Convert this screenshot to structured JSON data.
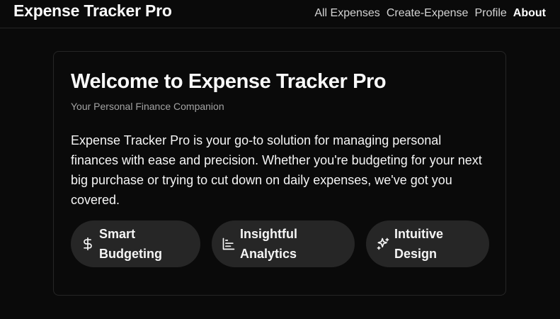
{
  "app": {
    "brand": "Expense Tracker Pro"
  },
  "nav": {
    "links": [
      {
        "label": "All Expenses"
      },
      {
        "label": "Create-Expense"
      },
      {
        "label": "Profile"
      },
      {
        "label": "About",
        "active": true
      }
    ]
  },
  "about": {
    "title": "Welcome to Expense Tracker Pro",
    "subtitle": "Your Personal Finance Companion",
    "description": "Expense Tracker Pro is your go-to solution for managing personal finances with ease and precision. Whether you're budgeting for your next big purchase or trying to cut down on daily expenses, we've got you covered.",
    "features": [
      {
        "icon": "dollar-sign-icon",
        "label_line1": "Smart",
        "label_line2": "Budgeting"
      },
      {
        "icon": "bar-chart-icon",
        "label_line1": "Insightful",
        "label_line2": "Analytics"
      },
      {
        "icon": "sparkles-icon",
        "label_line1": "Intuitive",
        "label_line2": "Design"
      }
    ]
  },
  "colors": {
    "background": "#0a0a0a",
    "border": "#262626",
    "pill": "#262626",
    "text": "#fafafa",
    "muted": "#a3a3a3"
  }
}
